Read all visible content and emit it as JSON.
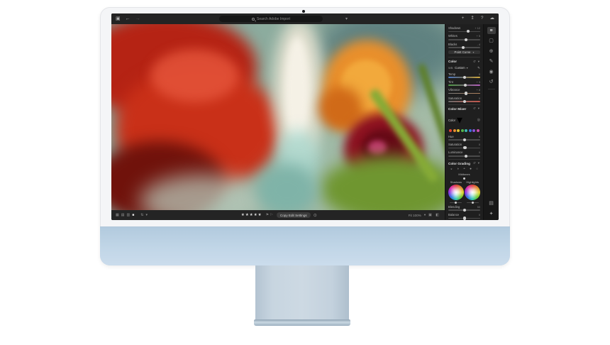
{
  "device": {
    "chin_color": "#bcd2e4",
    "stand_color": "#c4d2dе",
    "bezel_color": "#f4f5f7"
  },
  "icons": {
    "photos": "▣",
    "back": "←",
    "forward": "→",
    "filter": "▾",
    "add": "+",
    "share": "↥",
    "help": "?",
    "cloud": "☁",
    "view_grid": "▦",
    "view_detail": "▤",
    "view_compare": "▥",
    "view_single": "■",
    "sort": "⇅",
    "chevron": "▾",
    "flag_pick": "⚑",
    "flag_reject": "⚐",
    "more": "⊙",
    "fit_icons": "▣ ◧",
    "wb_eyedropper": "✎",
    "target": "◎",
    "reset": "↺",
    "rail_edit": "≡",
    "rail_crop": "▢",
    "rail_heal": "⊕",
    "rail_brush": "✎",
    "rail_eye": "◉",
    "rail_history": "↺",
    "rail_info": "▤",
    "rail_presets": "✦",
    "grading_modes": [
      "◒",
      "◑",
      "◓",
      "●",
      "○"
    ]
  },
  "topbar": {
    "search_placeholder": "Search Adobe Import"
  },
  "artwork": {
    "palette": {
      "background_sage": "#8fae9f",
      "gladiolus_red": "#c5291a",
      "deep_red": "#70120b",
      "orange_flower": "#e98f2b",
      "crimson_orchid": "#8c1120",
      "stem_green": "#6f9630",
      "cream_splash": "#efe9d8",
      "cyan_tendril": "#a9d8cf"
    }
  },
  "panel": {
    "light": {
      "sliders": [
        {
          "label": "Shadows",
          "value": "+ 12",
          "pos": "62%"
        },
        {
          "label": "Whites",
          "value": "+ 5",
          "pos": "55%"
        },
        {
          "label": "Blacks",
          "value": "- 4",
          "pos": "46%"
        }
      ],
      "point_curve": "Point Curve"
    },
    "color": {
      "header": "Color",
      "wb_prefix": "WB:",
      "wb_value": "Custom",
      "sliders": [
        {
          "label": "Temp",
          "value": "0",
          "pos": "50%"
        },
        {
          "label": "Tint",
          "value": "+ 3",
          "pos": "53%"
        },
        {
          "label": "Vibrance",
          "value": "+ 8",
          "pos": "55%"
        },
        {
          "label": "Saturation",
          "value": "0",
          "pos": "50%"
        }
      ]
    },
    "mixer": {
      "header": "Color Mixer",
      "mode": "Color",
      "dot_colors": [
        "#e2452f",
        "#e78a2e",
        "#e0c22f",
        "#54b348",
        "#3db8ae",
        "#3f6fd9",
        "#8a52d8",
        "#ca4fae"
      ],
      "sliders": [
        {
          "label": "Hue",
          "value": "0",
          "pos": "50%"
        },
        {
          "label": "Saturation",
          "value": "0",
          "pos": "52%"
        },
        {
          "label": "Luminance",
          "value": "0",
          "pos": "55%"
        }
      ]
    },
    "grading": {
      "header": "Color Grading",
      "wheels": [
        {
          "label": "Midtones"
        },
        {
          "label": "Shadows"
        },
        {
          "label": "Highlights"
        }
      ],
      "sliders": [
        {
          "label": "Blending",
          "value": "50",
          "pos": "50%"
        },
        {
          "label": "Balance",
          "value": "0",
          "pos": "50%"
        }
      ]
    }
  },
  "bottombar": {
    "stars": "★★★★★",
    "copy_button": "Copy Edit Settings",
    "zoom_label": "Fit   100%"
  }
}
